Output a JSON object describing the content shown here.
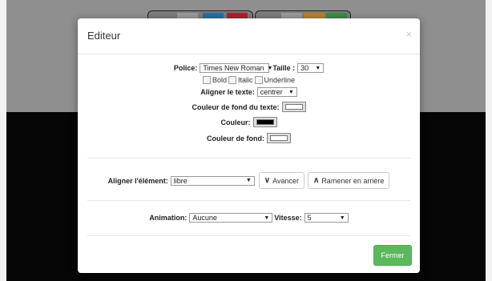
{
  "background": {
    "toolbar_left_swatches": [
      "#7d7d7d",
      "#9a9a9a",
      "#2a6f9e",
      "#a8242e"
    ],
    "toolbar_right_swatches": [
      "#7d7d7d",
      "#9a9a9a",
      "#b5832b",
      "#3d8a4a"
    ]
  },
  "modal": {
    "title": "Editeur",
    "close_glyph": "×",
    "font": {
      "police_label": "Police:",
      "police_value": "Times New Roman",
      "taille_label": "Taille :",
      "taille_value": "30"
    },
    "styles": {
      "bold": "Bold",
      "italic": "Italic",
      "underline": "Underline"
    },
    "align_text": {
      "label": "Aligner le texte:",
      "value": "centrer"
    },
    "text_bg_color": {
      "label": "Couleur de fond du texte:",
      "color": "#ffffff"
    },
    "color": {
      "label": "Couleur:",
      "color": "#000000"
    },
    "bg_color": {
      "label": "Couleur de fond:",
      "color": "#ffffff"
    },
    "align_element": {
      "label": "Aligner l'élément:",
      "value": "libre",
      "forward_label": "Avancer",
      "back_label": "Ramener en arrière"
    },
    "animation": {
      "label": "Animation:",
      "value": "Aucune",
      "speed_label": "Vitesse:",
      "speed_value": "5"
    },
    "close_button": "Fermer",
    "accent_color": "#5cb85c"
  }
}
